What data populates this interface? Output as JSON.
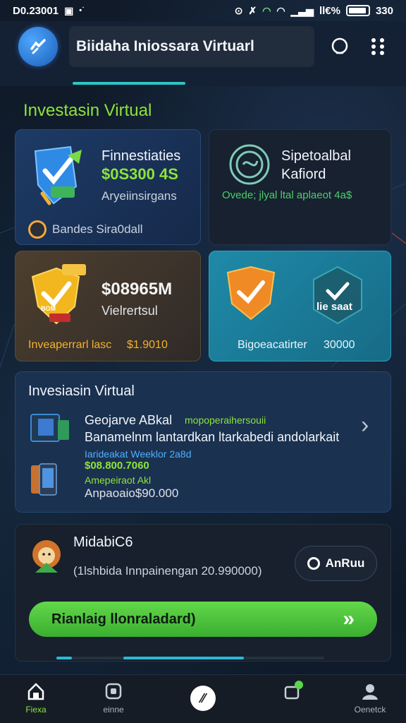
{
  "status_bar": {
    "time_left": "D0.23001",
    "battery_text": "ll€%",
    "time_right": "330"
  },
  "header": {
    "title": "Biidaha Iniossara Virtuarl"
  },
  "section_title": "Investasin Virtual",
  "cards": {
    "card1": {
      "title": "Finnestiaties",
      "amount": "$0S300 4S",
      "subtitle": "Aryeiinsirgans",
      "footer": "Bandes Sira0dall"
    },
    "card2": {
      "title_line1": "Sipetoalbal",
      "title_line2": "Kafiord",
      "subtitle": "Ovede; jlyal ltal aplaeot 4a$",
      "subtitle_color": "#49d06a"
    },
    "card3": {
      "badge": "BOM",
      "amount": "$08965M",
      "subtitle": "Vielrertsul",
      "footer_label": "Inveaperrarl lasc",
      "footer_value": "$1.9010"
    },
    "card4": {
      "shield_text": "lie saat",
      "footer_label": "Bigoeacatirter",
      "footer_value": "30000"
    }
  },
  "invest_panel": {
    "title": "Invesiasin Virtual",
    "item_title": "Geojarve ABkal",
    "item_tag": "mopoperaihersouii",
    "description": "Banamelnm lantardkan ltarkabedi andolarkait",
    "link_text": "Iarideakat Weeklor 2a8d",
    "amount": "$08.800.7060",
    "small_label": "Amepeiraot Akl",
    "total": "Anpaoaio$90.000"
  },
  "reward_panel": {
    "title": "MidabiC6",
    "description": "(1lshbida Innpainengan 20.990000)",
    "pill_label": "AnRuu",
    "cta_label": "Rianlaig llonraladard)",
    "cta_icon": "»",
    "progress_fraction": 0.6
  },
  "nav": {
    "items": [
      {
        "label": "Fiexa",
        "icon": "home-icon",
        "active": true
      },
      {
        "label": "einne",
        "icon": "square-icon"
      },
      {
        "label": "",
        "icon": "center-action-icon"
      },
      {
        "label": "",
        "icon": "notification-icon"
      },
      {
        "label": "Oenetck",
        "icon": "profile-icon"
      }
    ]
  },
  "colors": {
    "accent_green": "#8ee33a",
    "cta_green": "#4fc63c",
    "cyan": "#2ec4c4"
  }
}
